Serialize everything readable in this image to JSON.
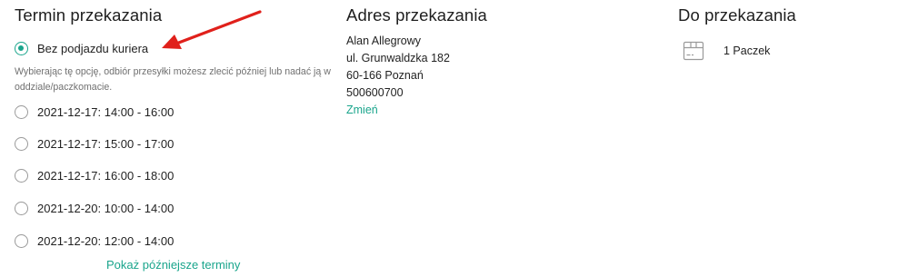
{
  "term": {
    "title": "Termin przekazania",
    "no_pickup_option": "Bez podjazdu kuriera",
    "hint": "Wybierając tę opcję, odbiór przesyłki możesz zlecić później lub nadać ją w oddziale/paczkomacie.",
    "slots": [
      "2021-12-17: 14:00 - 16:00",
      "2021-12-17: 15:00 - 17:00",
      "2021-12-17: 16:00 - 18:00",
      "2021-12-20: 10:00 - 14:00",
      "2021-12-20: 12:00 - 14:00"
    ],
    "more_link": "Pokaż późniejsze terminy"
  },
  "address": {
    "title": "Adres przekazania",
    "name": "Alan Allegrowy",
    "street": "ul. Grunwaldzka 182",
    "city": "60-166 Poznań",
    "phone": "500600700",
    "change_link": "Zmień"
  },
  "package": {
    "title": "Do przekazania",
    "count_text": "1 Paczek",
    "icon": "package-box-icon"
  },
  "colors": {
    "accent": "#1aa58c",
    "annotation_arrow": "#e0201b"
  }
}
